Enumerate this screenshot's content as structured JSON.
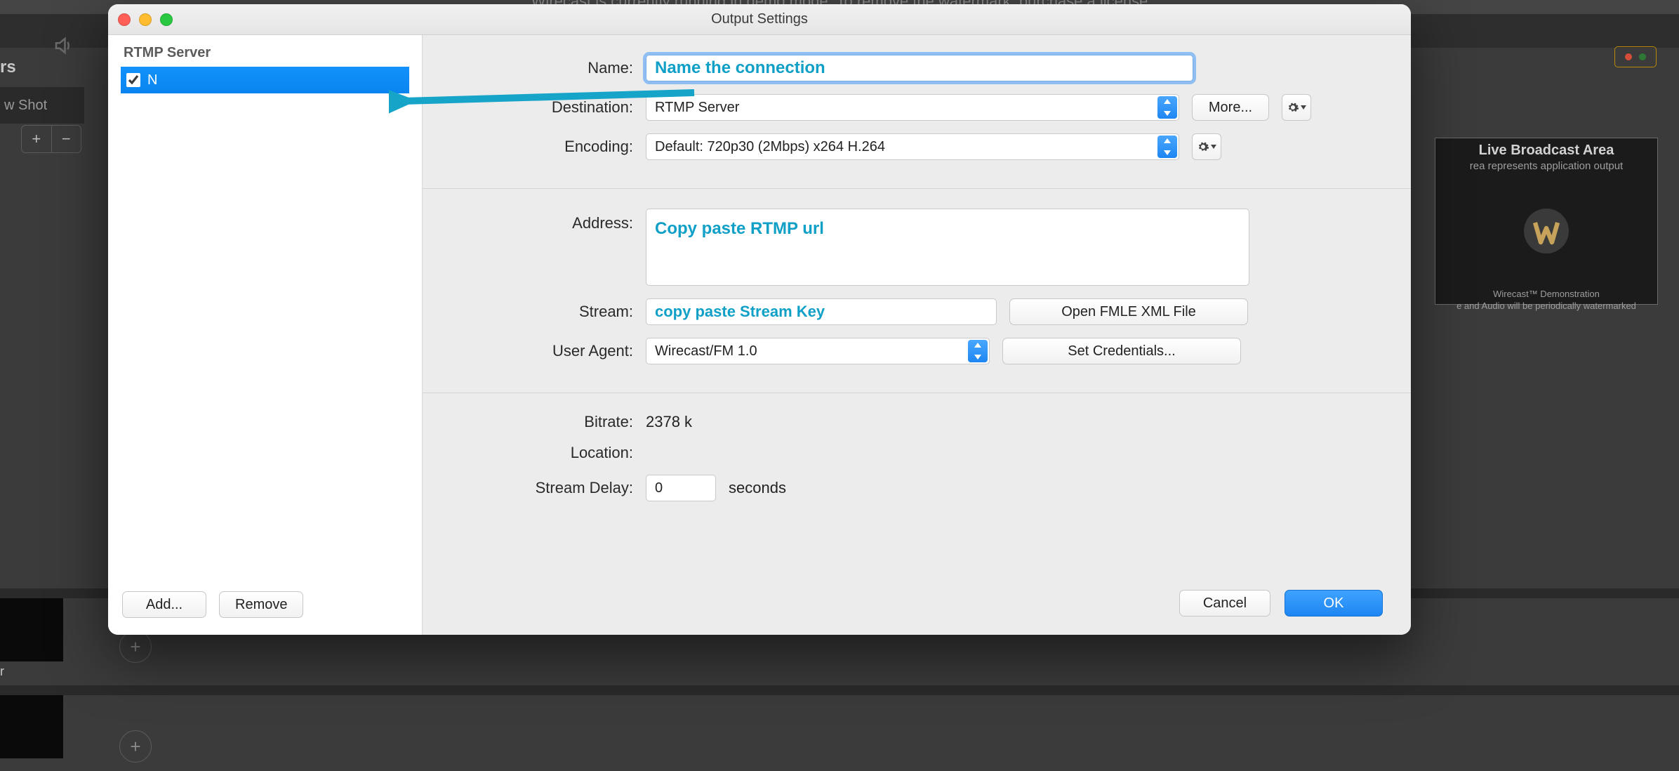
{
  "banner": "Wirecast is currently running in demo mode. To remove the watermark,    purchase a license",
  "bg": {
    "layers_label": "rs",
    "shot_tab": "w Shot",
    "row_label": "r",
    "broadcast": {
      "title": "Live Broadcast Area",
      "subtitle": "rea represents application output",
      "foot1": "Wirecast™ Demonstration",
      "foot2": "e and Audio will be periodically watermarked"
    }
  },
  "modal": {
    "title": "Output Settings",
    "traffic": {
      "red": "#ff5f57",
      "yellow": "#febc2e",
      "green": "#28c840"
    },
    "sidebar": {
      "heading": "RTMP Server",
      "item_label": "N",
      "item_checked": true,
      "add": "Add...",
      "remove": "Remove"
    },
    "form": {
      "name_label": "Name:",
      "name_placeholder": "Name the connection",
      "destination_label": "Destination:",
      "destination_value": "RTMP Server",
      "more_button": "More...",
      "encoding_label": "Encoding:",
      "encoding_value": "Default: 720p30 (2Mbps) x264 H.264",
      "address_label": "Address:",
      "address_placeholder": "Copy paste RTMP url",
      "stream_label": "Stream:",
      "stream_placeholder": "copy paste Stream Key",
      "open_fmle": "Open FMLE XML File",
      "useragent_label": "User Agent:",
      "useragent_value": "Wirecast/FM 1.0",
      "set_credentials": "Set Credentials...",
      "bitrate_label": "Bitrate:",
      "bitrate_value": "2378 k",
      "location_label": "Location:",
      "location_value": "",
      "delay_label": "Stream Delay:",
      "delay_value": "0",
      "delay_unit": "seconds",
      "cancel": "Cancel",
      "ok": "OK"
    }
  }
}
